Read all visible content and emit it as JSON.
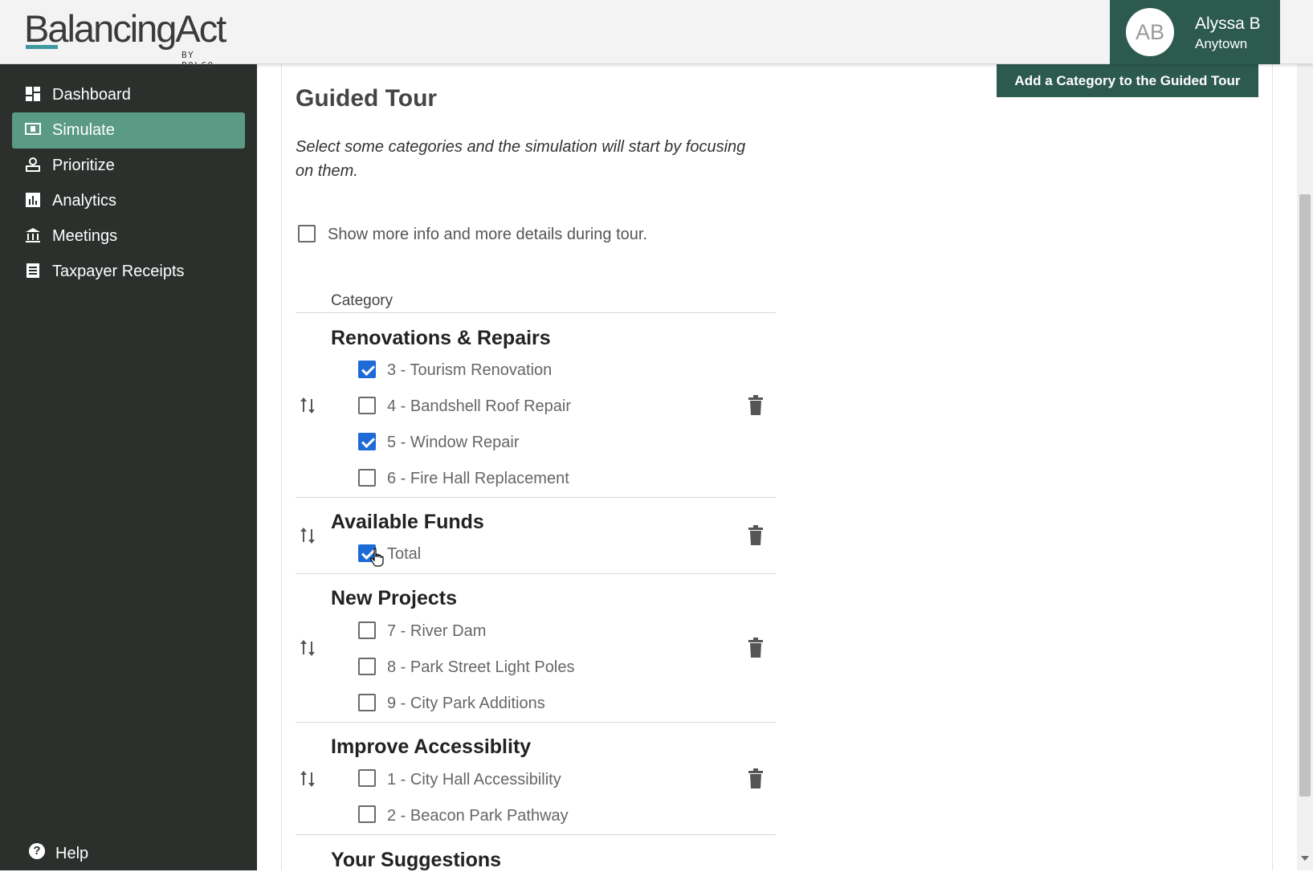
{
  "header": {
    "logo_text": "BalancingAct",
    "logo_sub": "BY POLCO",
    "user": {
      "initials": "AB",
      "name": "Alyssa B",
      "town": "Anytown"
    }
  },
  "sidebar": {
    "items": [
      {
        "label": "Dashboard",
        "icon": "dashboard-icon",
        "active": false
      },
      {
        "label": "Simulate",
        "icon": "simulate-icon",
        "active": true
      },
      {
        "label": "Prioritize",
        "icon": "prioritize-icon",
        "active": false
      },
      {
        "label": "Analytics",
        "icon": "analytics-icon",
        "active": false
      },
      {
        "label": "Meetings",
        "icon": "meetings-icon",
        "active": false
      },
      {
        "label": "Taxpayer Receipts",
        "icon": "receipt-icon",
        "active": false
      }
    ],
    "help_label": "Help",
    "help_glyph": "?"
  },
  "main": {
    "add_category_label": "Add a Category to the Guided Tour",
    "title": "Guided Tour",
    "description": "Select some categories and the simulation will start by focusing on them.",
    "show_more_label": "Show more info and more details during tour.",
    "show_more_checked": false,
    "column_header": "Category",
    "categories": [
      {
        "title": "Renovations & Repairs",
        "items": [
          {
            "label": "3 - Tourism Renovation",
            "checked": true
          },
          {
            "label": "4 - Bandshell Roof Repair",
            "checked": false
          },
          {
            "label": "5 - Window Repair",
            "checked": true
          },
          {
            "label": "6 - Fire Hall Replacement",
            "checked": false
          }
        ]
      },
      {
        "title": "Available Funds",
        "items": [
          {
            "label": "Total",
            "checked": true
          }
        ]
      },
      {
        "title": "New Projects",
        "items": [
          {
            "label": "7 - River Dam",
            "checked": false
          },
          {
            "label": "8 - Park Street Light Poles",
            "checked": false
          },
          {
            "label": "9 - City Park Additions",
            "checked": false
          }
        ]
      },
      {
        "title": "Improve Accessiblity",
        "items": [
          {
            "label": "1 - City Hall Accessibility",
            "checked": false
          },
          {
            "label": "2 - Beacon Park Pathway",
            "checked": false
          }
        ]
      },
      {
        "title": "Your Suggestions",
        "items": []
      }
    ]
  },
  "colors": {
    "brand_dark_green": "#2d5a4f",
    "active_nav": "#5b9b86",
    "sidebar_bg": "#2c302d",
    "checkbox_blue": "#1e6ad6"
  }
}
